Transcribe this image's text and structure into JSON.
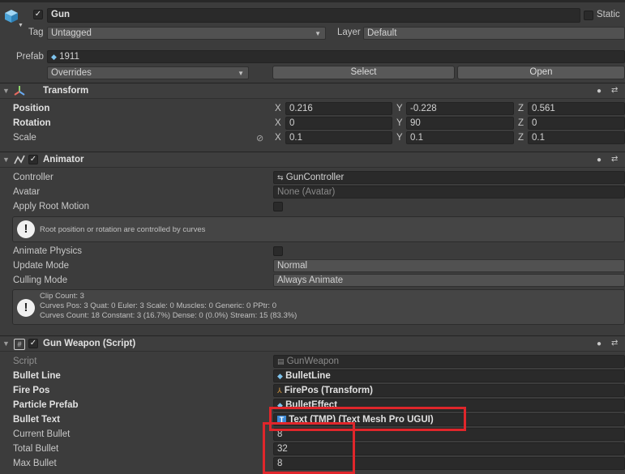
{
  "object": {
    "name": "Gun",
    "static_label": "Static",
    "tag_label": "Tag",
    "tag_value": "Untagged",
    "layer_label": "Layer",
    "layer_value": "Default",
    "prefab_label": "Prefab",
    "prefab_value": "1911",
    "overrides_label": "Overrides",
    "select_label": "Select",
    "open_label": "Open"
  },
  "transform": {
    "title": "Transform",
    "rows": [
      {
        "label": "Position",
        "x": "0.216",
        "y": "-0.228",
        "z": "0.561"
      },
      {
        "label": "Rotation",
        "x": "0",
        "y": "90",
        "z": "0"
      },
      {
        "label": "Scale",
        "x": "0.1",
        "y": "0.1",
        "z": "0.1"
      }
    ],
    "axis_x": "X",
    "axis_y": "Y",
    "axis_z": "Z"
  },
  "animator": {
    "title": "Animator",
    "controller_label": "Controller",
    "controller_value": "GunController",
    "avatar_label": "Avatar",
    "avatar_value": "None (Avatar)",
    "root_motion_label": "Apply Root Motion",
    "help_root": "Root position or rotation are controlled by curves",
    "animate_physics_label": "Animate Physics",
    "update_mode_label": "Update Mode",
    "update_mode_value": "Normal",
    "culling_mode_label": "Culling Mode",
    "culling_mode_value": "Always Animate",
    "clip_line1": "Clip Count: 3",
    "clip_line2": "Curves Pos: 3 Quat: 0 Euler: 3 Scale: 0 Muscles: 0 Generic: 0 PPtr: 0",
    "clip_line3": "Curves Count: 18 Constant: 3 (16.7%) Dense: 0 (0.0%) Stream: 15 (83.3%)"
  },
  "gunweapon": {
    "title": "Gun Weapon (Script)",
    "script_label": "Script",
    "script_value": "GunWeapon",
    "bullet_line_label": "Bullet Line",
    "bullet_line_value": "BulletLine",
    "fire_pos_label": "Fire Pos",
    "fire_pos_value": "FirePos (Transform)",
    "particle_label": "Particle Prefab",
    "particle_value": "BulletEffect",
    "bullet_text_label": "Bullet Text",
    "bullet_text_value": "Text (TMP) (Text Mesh Pro UGUI)",
    "current_bullet_label": "Current Bullet",
    "current_bullet_value": "8",
    "total_bullet_label": "Total Bullet",
    "total_bullet_value": "32",
    "max_bullet_label": "Max Bullet",
    "max_bullet_value": "8"
  },
  "colors": {
    "background": "#3c3c3c",
    "field": "#2a2a2a",
    "highlight": "#e0262b"
  },
  "icons": [
    "cube-icon",
    "checkbox-icon",
    "transform-icon",
    "animator-icon",
    "script-icon",
    "help-icon",
    "preset-icon",
    "info-icon",
    "link-icon",
    "prefab-icon",
    "controller-icon"
  ]
}
